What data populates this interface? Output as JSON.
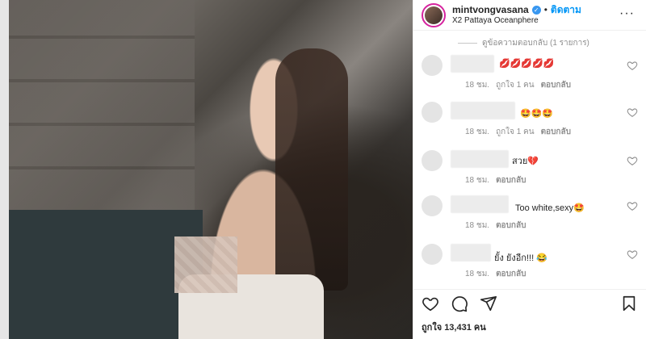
{
  "header": {
    "username": "mintvongvasana",
    "follow_label": "ติดตาม",
    "separator": "•",
    "location": "X2 Pattaya Oceanphere",
    "more_label": "···"
  },
  "thread": {
    "view_replies_label": "ดูข้อความตอบกลับ (1 รายการ)"
  },
  "comments": [
    {
      "text": "💋💋💋💋💋",
      "time": "18 ชม.",
      "likes": "ถูกใจ 1 คน",
      "reply": "ตอบกลับ"
    },
    {
      "text": "🤩🤩🤩",
      "time": "18 ชม.",
      "likes": "ถูกใจ 1 คน",
      "reply": "ตอบกลับ"
    },
    {
      "text": "สวย💔",
      "time": "18 ชม.",
      "likes": "",
      "reply": "ตอบกลับ"
    },
    {
      "text": "Too white,sexy🤩",
      "time": "18 ชม.",
      "likes": "",
      "reply": "ตอบกลับ"
    },
    {
      "text": "ยั้ง ยังอีก!!! 😂",
      "time": "18 ชม.",
      "likes": "",
      "reply": "ตอบกลับ"
    }
  ],
  "footer": {
    "likes_text": "ถูกใจ 13,431 คน"
  },
  "icons": {
    "like": "heart-icon",
    "comment": "comment-icon",
    "share": "share-icon",
    "save": "bookmark-icon",
    "verified": "verified-badge-icon"
  },
  "colors": {
    "follow": "#0095f6",
    "verified": "#3897f0",
    "meta": "#8e8e8e",
    "text": "#262626"
  }
}
